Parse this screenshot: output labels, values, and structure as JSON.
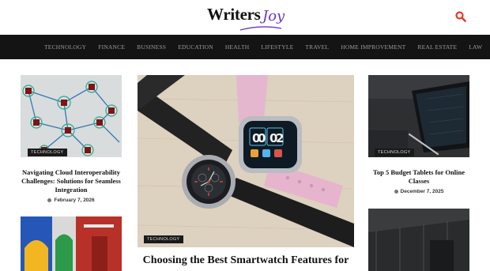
{
  "site": {
    "logo_main": "Writers",
    "logo_script": "Joy"
  },
  "nav": [
    "TECHNOLOGY",
    "FINANCE",
    "BUSINESS",
    "EDUCATION",
    "HEALTH",
    "LIFESTYLE",
    "TRAVEL",
    "HOME IMPROVEMENT",
    "REAL ESTATE",
    "LAW"
  ],
  "articles": {
    "left_top": {
      "tag": "TECHNOLOGY",
      "title": "Navigating Cloud Interoperability Challenges: Solutions for Seamless Integration",
      "date": "February 7, 2026"
    },
    "center": {
      "tag": "TECHNOLOGY",
      "title": "Choosing the Best Smartwatch Features for"
    },
    "right_top": {
      "tag": "TECHNOLOGY",
      "title": "Top 5 Budget Tablets for Online Classes",
      "date": "December 7, 2025"
    }
  },
  "colors": {
    "nav_bg": "#141414",
    "accent": "#6a35c9",
    "search": "#e63a2a"
  }
}
